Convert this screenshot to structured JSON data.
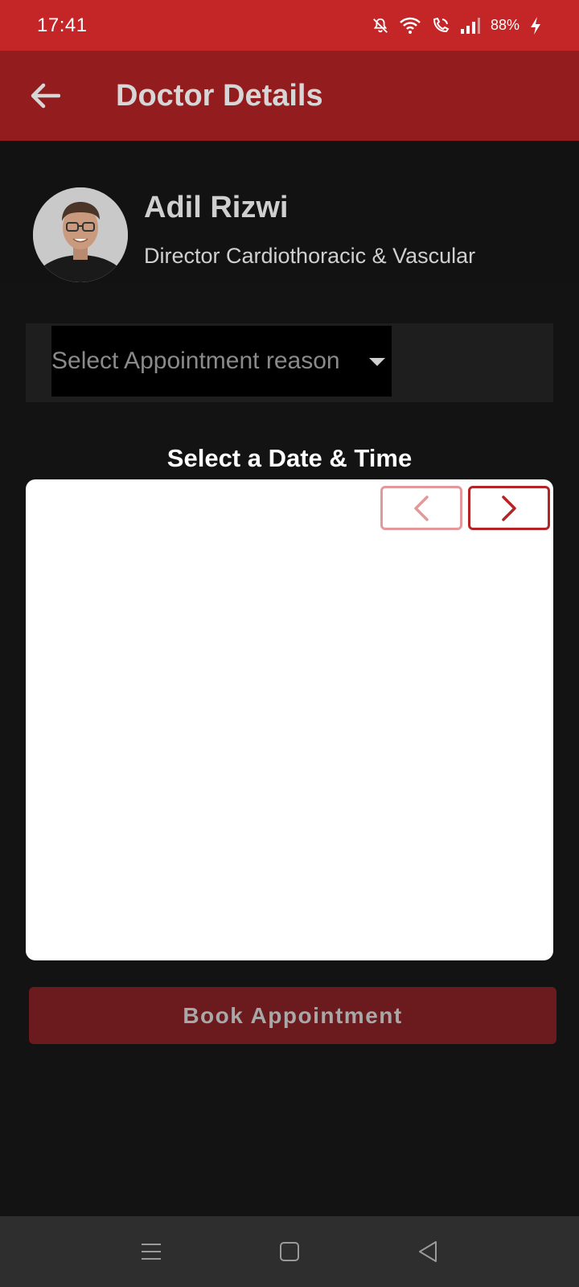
{
  "status_bar": {
    "time": "17:41",
    "battery": "88%",
    "icons": [
      "mute-icon",
      "wifi-icon",
      "wifi-calling-icon",
      "signal-icon",
      "charging-icon"
    ]
  },
  "app_bar": {
    "title": "Doctor Details",
    "back_icon": "back-arrow-icon"
  },
  "doctor": {
    "name": "Adil Rizwi",
    "title": "Director Cardiothoracic & Vascular"
  },
  "appointment": {
    "reason_placeholder": "Select Appointment reason"
  },
  "schedule": {
    "heading": "Select a Date & Time",
    "prev_icon": "chevron-left-icon",
    "next_icon": "chevron-right-icon"
  },
  "actions": {
    "book_label": "Book Appointment"
  },
  "colors": {
    "status_bar": "#c42527",
    "app_bar": "#931c1e",
    "background": "#131313",
    "book_button": "#6b1a1d",
    "accent": "#b42426"
  },
  "system_nav": {
    "icons": [
      "menu-icon",
      "home-icon",
      "back-icon"
    ]
  }
}
